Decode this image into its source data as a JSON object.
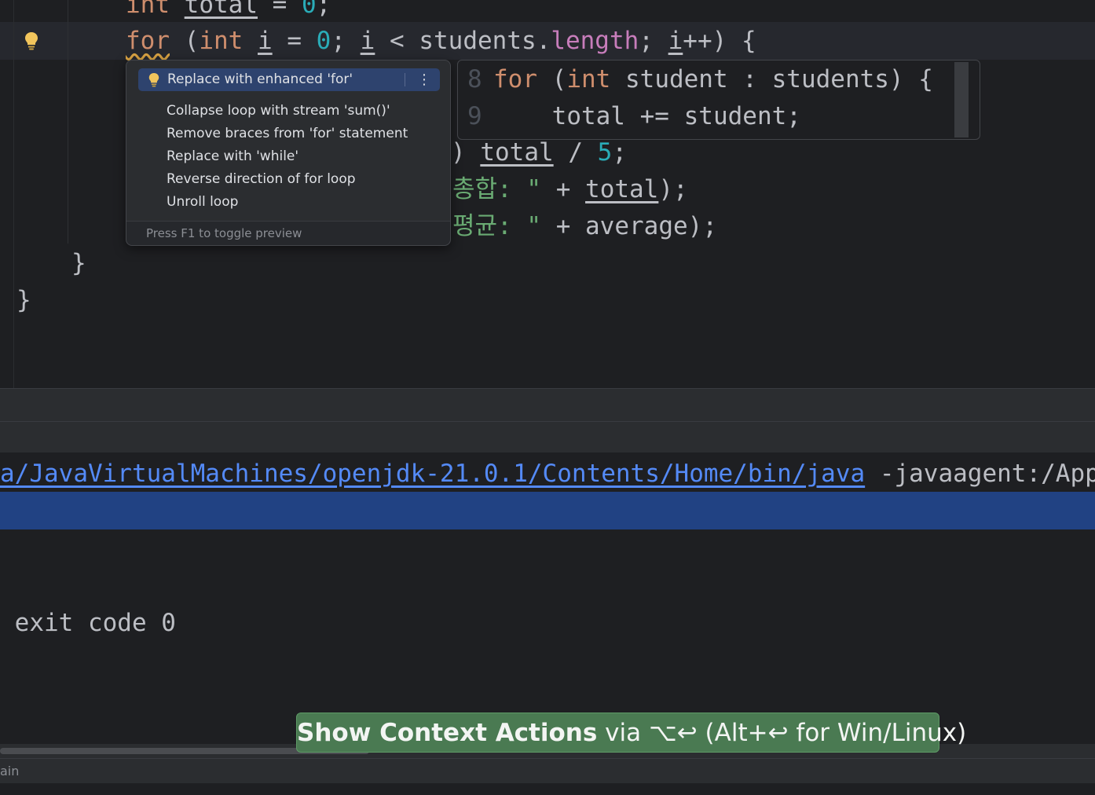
{
  "editor": {
    "lines": {
      "l0_kw": "int",
      "l0_var": "total",
      "l0_eq": " = ",
      "l0_num": "0",
      "l0_end": ";",
      "l1_kw": "for",
      "l1_a": " (",
      "l1_int": "int",
      "l1_b": " ",
      "l1_i1": "i",
      "l1_c": " = ",
      "l1_zero": "0",
      "l1_d": "; ",
      "l1_i2": "i",
      "l1_e": " < students.",
      "l1_len": "length",
      "l1_f": "; ",
      "l1_i3": "i",
      "l1_g": "++) {",
      "l2_a": ") ",
      "l2_total": "total",
      "l2_b": " / ",
      "l2_five": "5",
      "l2_c": ";",
      "l3_str": "총합: \"",
      "l3_b": " + ",
      "l3_total": "total",
      "l3_c": ");",
      "l4_str": "평균: \"",
      "l4_b": " + average);",
      "brace_inner": "}",
      "brace_outer": "}"
    }
  },
  "intention_popup": {
    "selected": "Replace with enhanced 'for'",
    "more_icon": "⋮",
    "items": [
      "Collapse loop with stream 'sum()'",
      "Remove braces from 'for' statement",
      "Replace with 'while'",
      "Reverse direction of for loop",
      "Unroll loop"
    ],
    "footer": "Press F1 to toggle preview"
  },
  "preview": {
    "line1_num": "8",
    "line1_kw": "for",
    "line1_a": " (",
    "line1_int": "int",
    "line1_b": " student : students) {",
    "line2_num": "9",
    "line2_code": "    total += student;"
  },
  "console": {
    "path_link": "a/JavaVirtualMachines/openjdk-21.0.1/Contents/Home/bin/java",
    "path_rest": " -javaagent:/Applicati",
    "exit_text": " exit code 0"
  },
  "status_bar": {
    "text": "ain"
  },
  "hint": {
    "bold": "Show Context Actions",
    "rest": " via ⌥↩ (Alt+↩ for Win/Linux)"
  },
  "colors": {
    "keyword": "#cf8e6d",
    "number": "#2aacb8",
    "field": "#c77dbb",
    "string": "#6aab73",
    "selection": "#2e436e",
    "hint_bg": "#4a7a52"
  }
}
